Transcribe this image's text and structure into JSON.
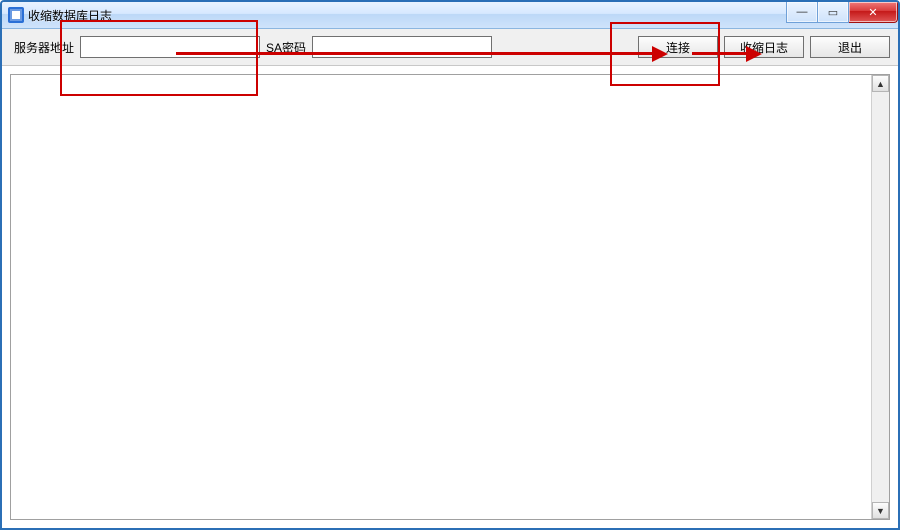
{
  "window": {
    "title": "收缩数据库日志"
  },
  "titlebar": {
    "min_glyph": "—",
    "max_glyph": "▭",
    "close_glyph": "✕"
  },
  "toolbar": {
    "server_label": "服务器地址",
    "server_value": "",
    "sa_label": "SA密码",
    "sa_value": "",
    "connect_label": "连接",
    "shrink_label": "收缩日志",
    "exit_label": "退出"
  },
  "scrollbar": {
    "up_glyph": "▲",
    "down_glyph": "▼"
  },
  "annotation": {
    "colors": {
      "highlight": "#cc0000"
    }
  }
}
